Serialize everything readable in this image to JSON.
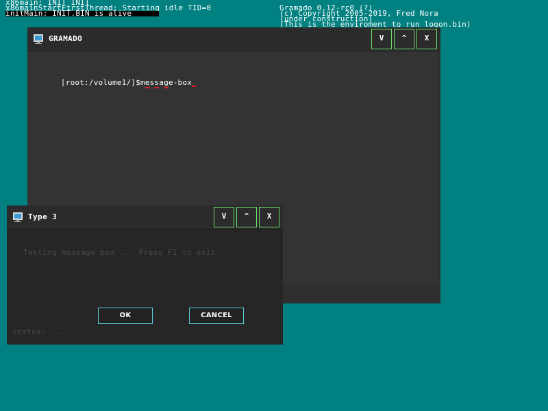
{
  "boot_log": {
    "left": [
      "x86main: INIT_INIT",
      "x86mainStartFirstThread: Starting idle TID=0",
      "initMain: INIT.BIN is alive"
    ],
    "right": [
      "Gramado 0.12-rc0 (?)",
      "(c) Copyright 2005-2019, Fred Nora",
      "(under construction)",
      "(This is the enviroment to run logon.bin)"
    ]
  },
  "main_window": {
    "title": "GRAMADO",
    "icon": "monitor-icon",
    "controls": {
      "minimize": "V",
      "maximize": "^",
      "close": "X"
    },
    "prompt": "[root:/volume1/]$",
    "command_parts": [
      "m",
      "e",
      "s",
      "s",
      "a",
      "g",
      "e",
      "-",
      "b",
      "o",
      "x"
    ]
  },
  "message_box": {
    "title": "Type 3",
    "icon": "monitor-icon",
    "controls": {
      "minimize": "V",
      "maximize": "^",
      "close": "X"
    },
    "message": "Testing message box ... Press F1 to exit.",
    "ok_label": "OK",
    "cancel_label": "CANCEL",
    "status": "Status: ..."
  },
  "colors": {
    "desktop": "#008080",
    "window_bg": "#2f2f2f",
    "control_border": "#6ce06c",
    "button_border": "#5ad0d8",
    "error_underline": "#e02020"
  }
}
